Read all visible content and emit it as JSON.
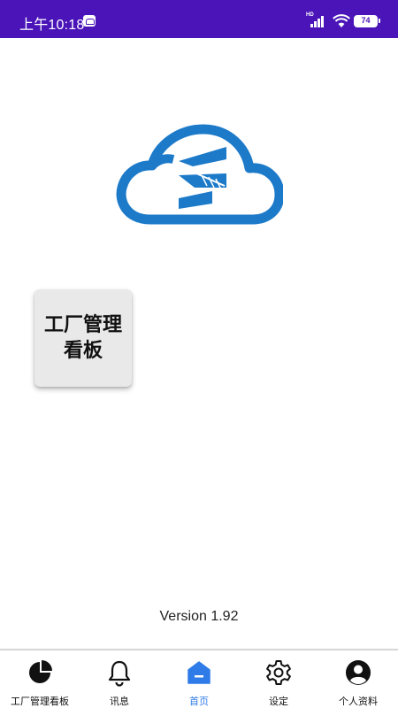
{
  "status_bar": {
    "time": "上午10:18",
    "signal_label": "HD",
    "battery": "74"
  },
  "home": {
    "tile_label": "工厂管理看板",
    "version": "Version 1.92"
  },
  "bottom_nav": {
    "items": [
      {
        "label": "工厂管理看板",
        "icon": "pie-chart-icon"
      },
      {
        "label": "讯息",
        "icon": "bell-icon"
      },
      {
        "label": "首页",
        "icon": "home-icon"
      },
      {
        "label": "设定",
        "icon": "gear-icon"
      },
      {
        "label": "个人资料",
        "icon": "user-icon"
      }
    ],
    "active_index": 2
  },
  "colors": {
    "status_bar": "#4a14b8",
    "accent": "#2f7be8",
    "logo_blue": "#1c7ac9"
  }
}
